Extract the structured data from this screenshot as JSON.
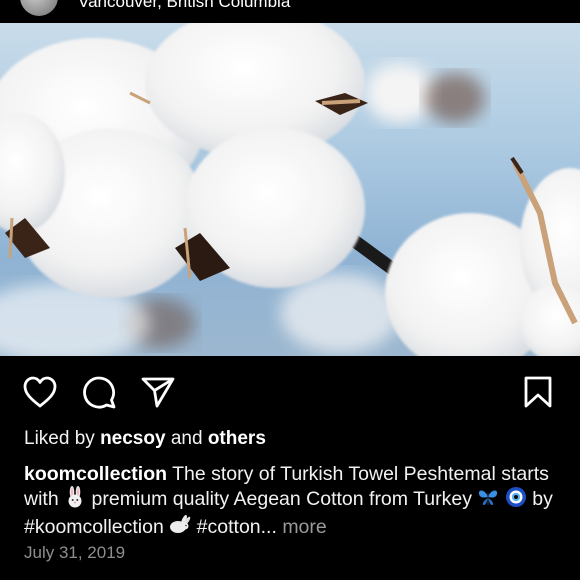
{
  "post": {
    "location": "Vancouver, British Columbia",
    "image_subject": "cotton bolls",
    "likes": {
      "prefix": "Liked by",
      "user": "necsoy",
      "joiner": "and",
      "others": "others"
    },
    "caption": {
      "username": "koomcollection",
      "part1": "The story of Turkish Towel Peshtemal starts with",
      "part2": "premium quality Aegean Cotton from Turkey",
      "part3": "by #koomcollection",
      "part4": "#cotton...",
      "more": "more",
      "emojis": [
        "rabbit-emoji",
        "butterfly-emoji",
        "nazar-amulet-emoji",
        "rabbit-emoji"
      ]
    },
    "date": "July 31, 2019"
  },
  "icons": {
    "like": "heart-outline-icon",
    "comment": "comment-bubble-icon",
    "share": "paper-plane-icon",
    "save": "bookmark-icon"
  },
  "colors": {
    "background": "#000000",
    "text": "#ffffff",
    "muted": "#8e8e8e"
  }
}
